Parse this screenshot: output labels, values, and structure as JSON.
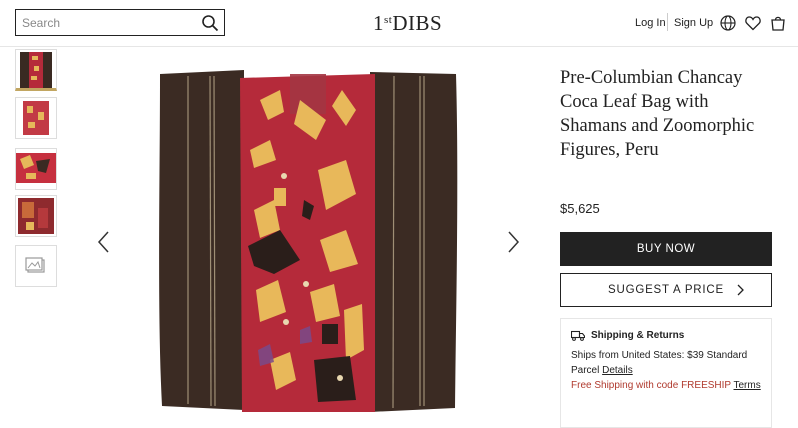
{
  "header": {
    "search_placeholder": "Search",
    "logo_main": "1",
    "logo_sup": "st",
    "logo_rest": "DIBS",
    "login": "Log In",
    "signup": "Sign Up",
    "icons": [
      "search-icon",
      "globe-icon",
      "heart-icon",
      "bag-icon"
    ]
  },
  "product": {
    "title": "Pre-Columbian Chancay Coca Leaf Bag with Shamans and Zoomorphic Figures, Peru",
    "price": "$5,625",
    "buy_label": "Buy Now",
    "suggest_label": "Suggest a Price"
  },
  "shipping": {
    "heading": "Shipping & Returns",
    "line1": "Ships from United States: $39 Standard",
    "line2_prefix": "Parcel ",
    "line2_link": "Details",
    "promo_prefix": "Free Shipping with code FREESHIP ",
    "promo_link": "Terms"
  },
  "gallery": {
    "thumbnails": [
      "textile-thumb-1",
      "textile-thumb-2",
      "textile-thumb-3",
      "textile-thumb-4",
      "more-images-icon"
    ],
    "active_index": 0
  },
  "colors": {
    "accent_gold": "#c2a661",
    "textile_red": "#b52a3a",
    "textile_brown": "#3a2a22",
    "promo_red": "#b03a2e"
  }
}
